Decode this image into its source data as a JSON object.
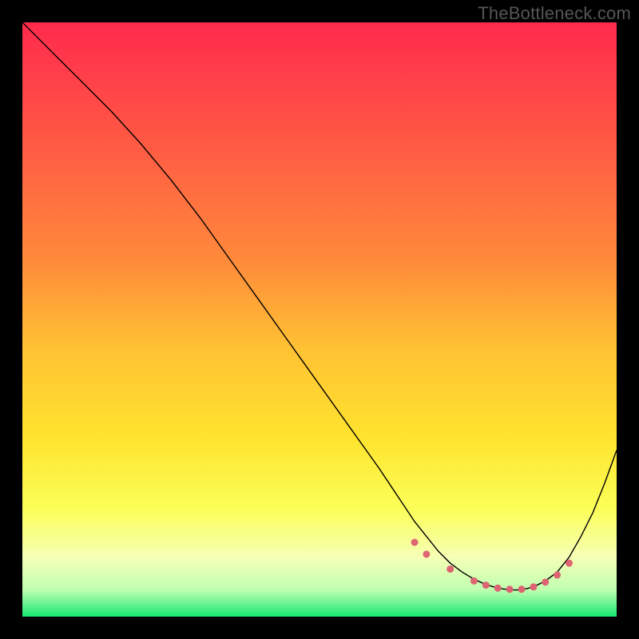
{
  "watermark": "TheBottleneck.com",
  "chart_data": {
    "type": "line",
    "title": "",
    "xlabel": "",
    "ylabel": "",
    "xlim": [
      0,
      100
    ],
    "ylim": [
      0,
      100
    ],
    "grid": false,
    "legend": false,
    "background_gradient": {
      "stops": [
        {
          "pos": 0.0,
          "color": "#ff2a4d"
        },
        {
          "pos": 0.2,
          "color": "#ff5944"
        },
        {
          "pos": 0.4,
          "color": "#ff8a3b"
        },
        {
          "pos": 0.55,
          "color": "#ffc233"
        },
        {
          "pos": 0.7,
          "color": "#ffe42e"
        },
        {
          "pos": 0.82,
          "color": "#fbff59"
        },
        {
          "pos": 0.9,
          "color": "#f6ffb6"
        },
        {
          "pos": 0.955,
          "color": "#bfffb0"
        },
        {
          "pos": 1.0,
          "color": "#17e874"
        }
      ]
    },
    "series": [
      {
        "name": "bottleneck-curve",
        "color": "#000000",
        "width": 1.4,
        "x": [
          0,
          5,
          10,
          15,
          20,
          25,
          30,
          35,
          40,
          45,
          50,
          55,
          60,
          62,
          64,
          66,
          68,
          70,
          72,
          74,
          76,
          78,
          80,
          82,
          84,
          86,
          88,
          90,
          92,
          94,
          96,
          98,
          100
        ],
        "y": [
          100,
          95,
          90,
          85,
          79.5,
          73.5,
          67,
          60,
          53,
          46,
          39,
          32,
          25,
          22,
          19,
          16,
          13.5,
          11,
          9,
          7.5,
          6.3,
          5.4,
          4.8,
          4.5,
          4.5,
          5.0,
          6.0,
          7.5,
          10.0,
          13.5,
          17.5,
          22.5,
          28.0
        ]
      }
    ],
    "markers": {
      "name": "pink-dots",
      "color": "#dd6472",
      "radius": 4.5,
      "x": [
        66,
        68,
        72,
        76,
        78,
        80,
        82,
        84,
        86,
        88,
        90,
        92
      ],
      "y": [
        12.5,
        10.5,
        8.0,
        6.0,
        5.3,
        4.8,
        4.6,
        4.6,
        5.0,
        5.8,
        7.0,
        9.0
      ]
    }
  }
}
